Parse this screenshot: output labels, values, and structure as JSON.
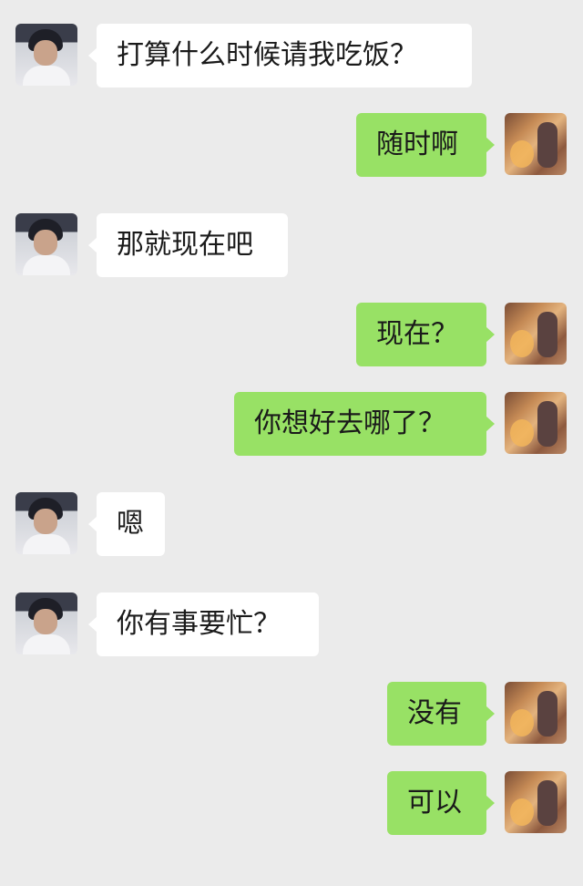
{
  "colors": {
    "background": "#ebebeb",
    "incoming_bubble": "#ffffff",
    "outgoing_bubble": "#98e165"
  },
  "messages": [
    {
      "sender": "them",
      "text": "打算什么时候请我吃饭？"
    },
    {
      "sender": "me",
      "text": "随时啊"
    },
    {
      "sender": "them",
      "text": "那就现在吧"
    },
    {
      "sender": "me",
      "text": "现在？"
    },
    {
      "sender": "me",
      "text": "你想好去哪了？"
    },
    {
      "sender": "them",
      "text": "嗯"
    },
    {
      "sender": "them",
      "text": "你有事要忙？"
    },
    {
      "sender": "me",
      "text": "没有"
    },
    {
      "sender": "me",
      "text": "可以"
    }
  ]
}
